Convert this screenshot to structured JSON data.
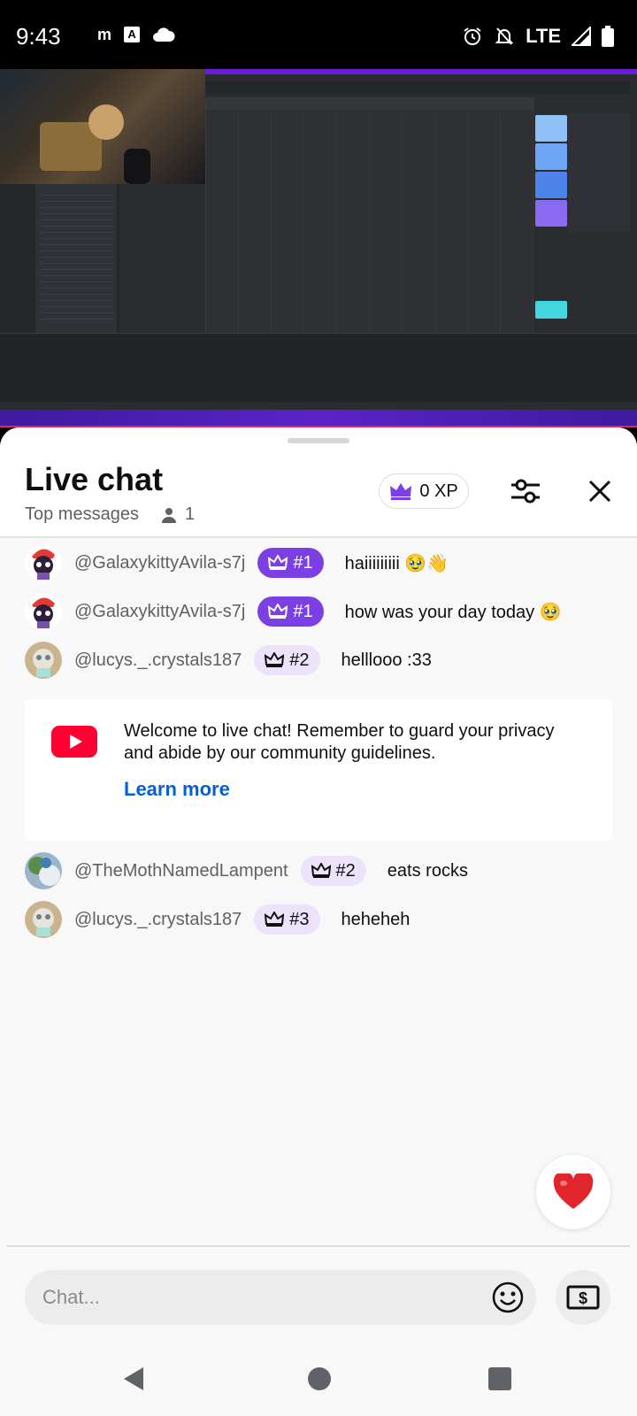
{
  "status_bar": {
    "time": "9:43",
    "network": "LTE",
    "icons": [
      "m-zone-icon",
      "a-icon",
      "cloud-icon",
      "alarm-icon",
      "bell-off-icon",
      "signal-icon",
      "battery-icon"
    ]
  },
  "video": {
    "description_icon": "stream-video"
  },
  "chat": {
    "title": "Live chat",
    "mode": "Top messages",
    "viewer_count": "1",
    "xp": "0 XP",
    "messages_before": [
      {
        "author": "@GalaxykittyAvila-s7j",
        "rank": "#1",
        "text": "haiiiiiiiii 🥹👋",
        "badge_style": "gold",
        "avatar": "galaxy"
      },
      {
        "author": "@GalaxykittyAvila-s7j",
        "rank": "#1",
        "text": "how was your day today 🥹",
        "badge_style": "gold",
        "avatar": "galaxy"
      },
      {
        "author": "@lucys._.crystals187",
        "rank": "#2",
        "text": "helllooo :33",
        "badge_style": "light",
        "avatar": "lucy"
      }
    ],
    "welcome": {
      "text": "Welcome to live chat! Remember to guard your privacy and abide by our community guidelines.",
      "link": "Learn more"
    },
    "messages_after": [
      {
        "author": "@TheMothNamedLampent",
        "rank": "#2",
        "text": "eats rocks",
        "badge_style": "light",
        "avatar": "moth"
      },
      {
        "author": "@lucys._.crystals187",
        "rank": "#3",
        "text": "heheheh",
        "badge_style": "light",
        "avatar": "lucy"
      }
    ],
    "input_placeholder": "Chat...",
    "accent": "#7b3fe4",
    "link_color": "#065fd4"
  }
}
